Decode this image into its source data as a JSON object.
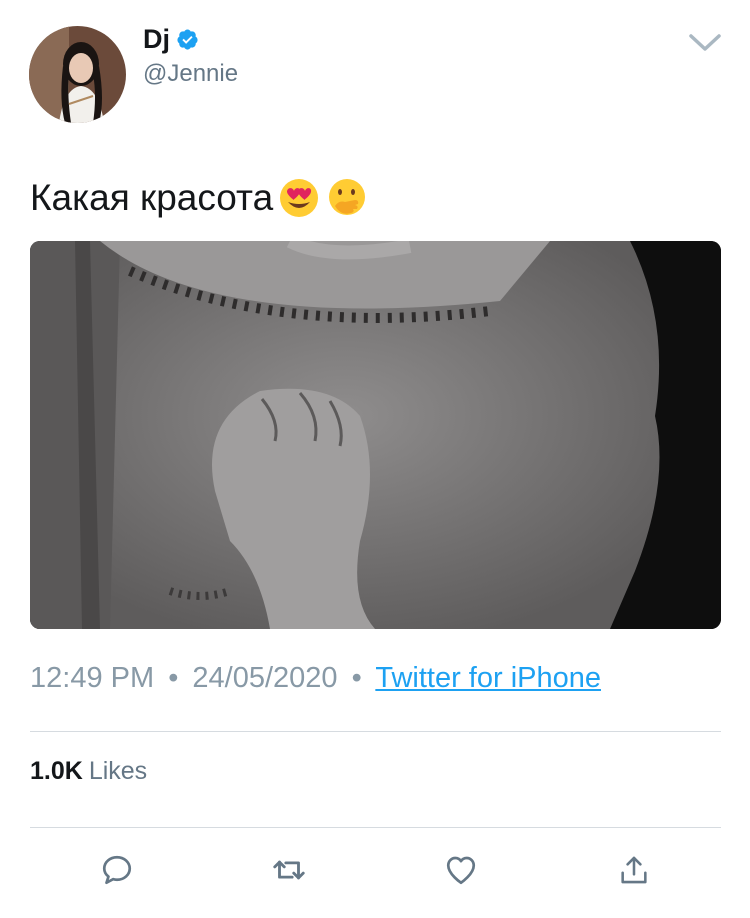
{
  "user": {
    "display_name": "Dj",
    "handle": "@Jennie",
    "verified": true
  },
  "tweet": {
    "text": "Какая красота",
    "emojis": [
      "heart-eyes-emoji",
      "hand-over-mouth-emoji"
    ],
    "time": "12:49 PM",
    "date": "24/05/2020",
    "separator": "•",
    "source": "Twitter for iPhone"
  },
  "stats": {
    "likes_count": "1.0K",
    "likes_label": "Likes"
  },
  "actions": [
    "reply-icon",
    "retweet-icon",
    "like-icon",
    "share-icon"
  ],
  "colors": {
    "link": "#1da1f2",
    "secondary_text": "#657786",
    "meta_text": "#8899a6",
    "divider": "#d6dbe0"
  }
}
